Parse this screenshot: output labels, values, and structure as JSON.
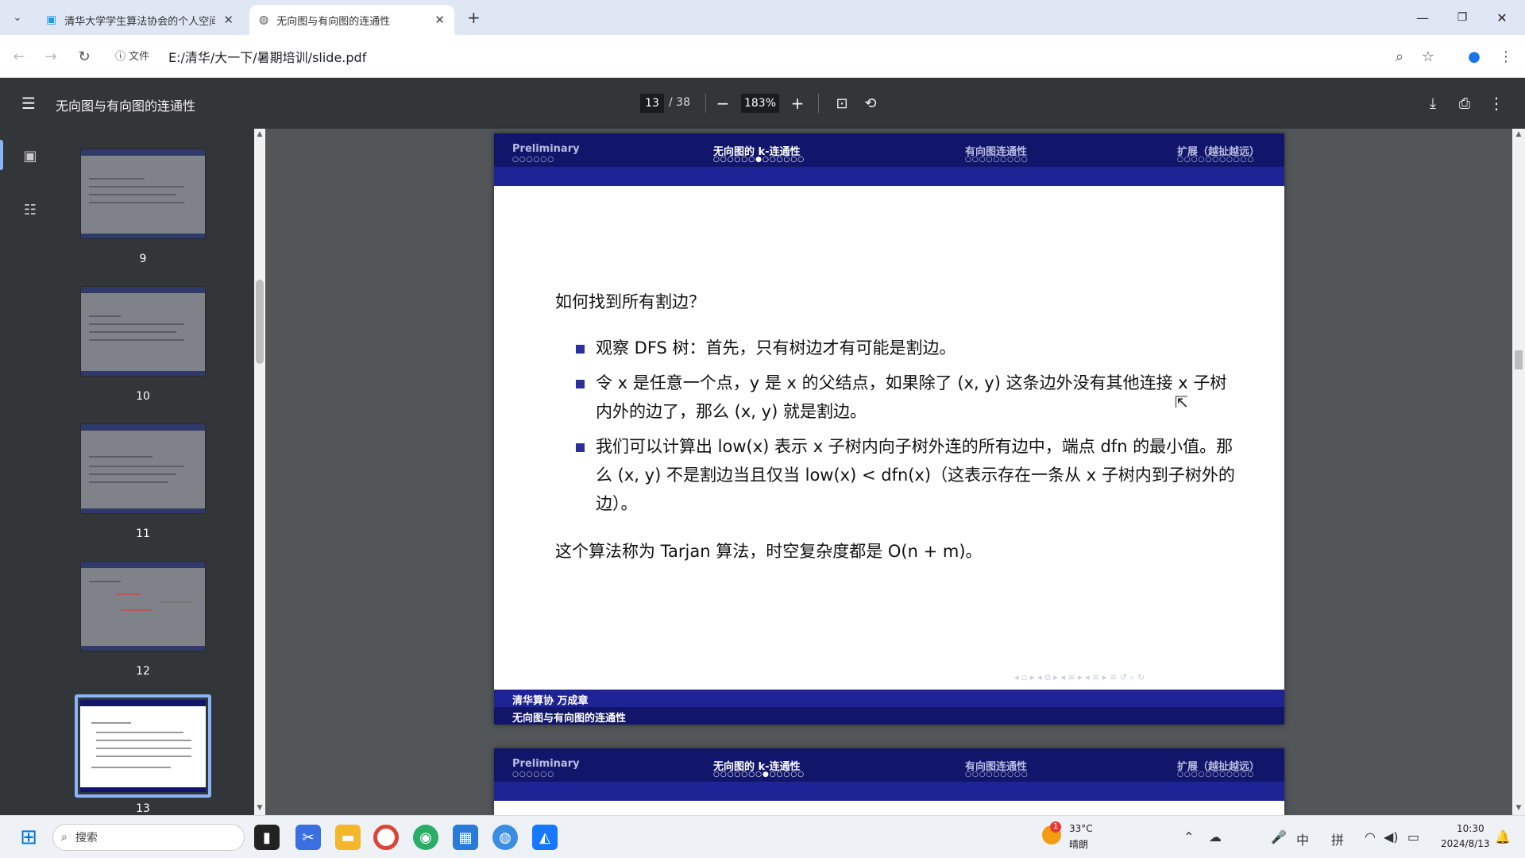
{
  "browser": {
    "tabs": [
      {
        "title": "清华大学学生算法协会的个人空间",
        "active": false
      },
      {
        "title": "无向图与有向图的连通性",
        "active": true
      }
    ],
    "new_tab_label": "+",
    "address": {
      "info_label": "文件",
      "url": "E:/清华/大一下/暑期培训/slide.pdf"
    }
  },
  "pdf_viewer": {
    "title": "无向图与有向图的连通性",
    "current_page": "13",
    "total_pages": "/ 38",
    "zoom": "183%",
    "thumbnails": [
      {
        "page": "9"
      },
      {
        "page": "10"
      },
      {
        "page": "11"
      },
      {
        "page": "12"
      },
      {
        "page": "13"
      }
    ]
  },
  "slide": {
    "nav_sections": [
      {
        "label": "Preliminary",
        "dots": "○○○○○○",
        "current": false
      },
      {
        "label": "无向图的 k-连通性",
        "dots": "○○○○○○●○○○○○○",
        "current": true
      },
      {
        "label": "有向图连通性",
        "dots": "○○○○○○○○○",
        "current": false
      },
      {
        "label": "扩展（越扯越远）",
        "dots": "○○○○○○○○○○○",
        "current": false
      }
    ],
    "question": "如何找到所有割边？",
    "bullets": [
      "观察 DFS 树：首先，只有树边才有可能是割边。",
      "令 x 是任意一个点，y 是 x 的父结点，如果除了 (x, y) 这条边外没有其他连接 x 子树内外的边了，那么 (x, y) 就是割边。",
      "我们可以计算出 low(x) 表示 x 子树内向子树外连的所有边中，端点 dfn 的最小值。那么 (x, y) 不是割边当且仅当 low(x) < dfn(x)（这表示存在一条从 x 子树内到子树外的边）。"
    ],
    "conclusion": "这个算法称为 Tarjan 算法，时空复杂度都是 O(n + m)。",
    "footer_author": "清华算协  万成章",
    "footer_title": "无向图与有向图的连通性",
    "next_slide_sections": [
      {
        "label": "Preliminary",
        "dots": "○○○○○○",
        "current": false
      },
      {
        "label": "无向图的 k-连通性",
        "dots": "○○○○○○○●○○○○○",
        "current": true
      },
      {
        "label": "有向图连通性",
        "dots": "○○○○○○○○○",
        "current": false
      },
      {
        "label": "扩展（越扯越远）",
        "dots": "○○○○○○○○○○○",
        "current": false
      }
    ]
  },
  "taskbar": {
    "search_placeholder": "搜索",
    "weather_temp": "33°C",
    "weather_desc": "晴朗",
    "weather_badge": "1",
    "ime1": "中",
    "ime2": "拼",
    "time": "10:30",
    "date": "2024/8/13"
  },
  "colors": {
    "beamer_dark": "#12166a",
    "beamer_mid": "#1e2396",
    "accent_blue": "#8ab4f8"
  }
}
